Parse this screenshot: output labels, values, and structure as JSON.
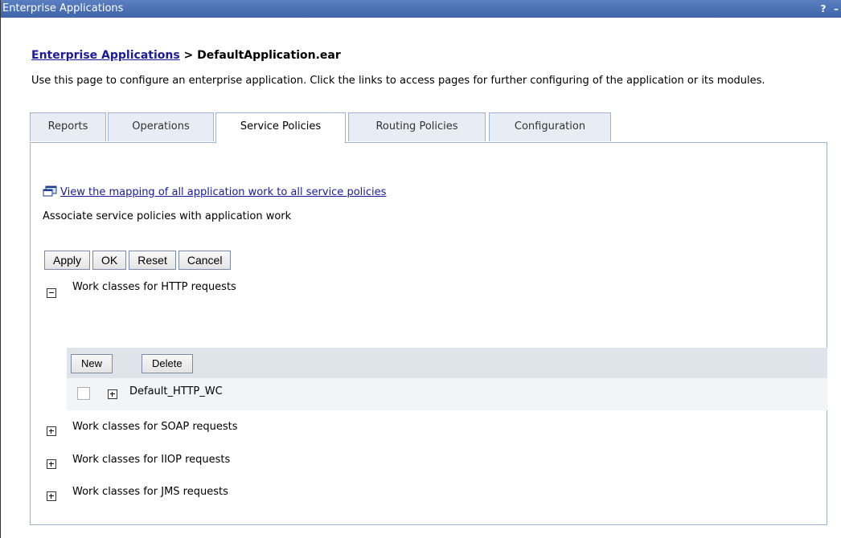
{
  "window": {
    "title": "Enterprise Applications",
    "help_label": "?",
    "minimize_label": "–"
  },
  "breadcrumb": {
    "link": "Enterprise Applications",
    "separator": " > ",
    "current": "DefaultApplication.ear"
  },
  "description": "Use this page to configure an enterprise application. Click the links to access pages for further configuring of the application or its modules.",
  "tabs": [
    {
      "label": "Reports",
      "active": false
    },
    {
      "label": "Operations",
      "active": false
    },
    {
      "label": "Service Policies",
      "active": true
    },
    {
      "label": "Routing Policies",
      "active": false
    },
    {
      "label": "Configuration",
      "active": false
    }
  ],
  "mapping_link": "View the mapping of all application work to all service policies",
  "associate_text": "Associate service policies with application work",
  "buttons": {
    "apply": "Apply",
    "ok": "OK",
    "reset": "Reset",
    "cancel": "Cancel"
  },
  "sections": [
    {
      "label": "Work classes for HTTP requests",
      "expanded": true
    },
    {
      "label": "Work classes for SOAP requests",
      "expanded": false
    },
    {
      "label": "Work classes for IIOP requests",
      "expanded": false
    },
    {
      "label": "Work classes for JMS requests",
      "expanded": false
    }
  ],
  "work_class_table": {
    "new_label": "New",
    "delete_label": "Delete",
    "rows": [
      {
        "name": "Default_HTTP_WC",
        "checked": false,
        "expanded": false
      }
    ]
  },
  "colors": {
    "titlebar": "#3f64a8",
    "link": "#1a1a9c",
    "tab_border": "#9eb3d3"
  }
}
